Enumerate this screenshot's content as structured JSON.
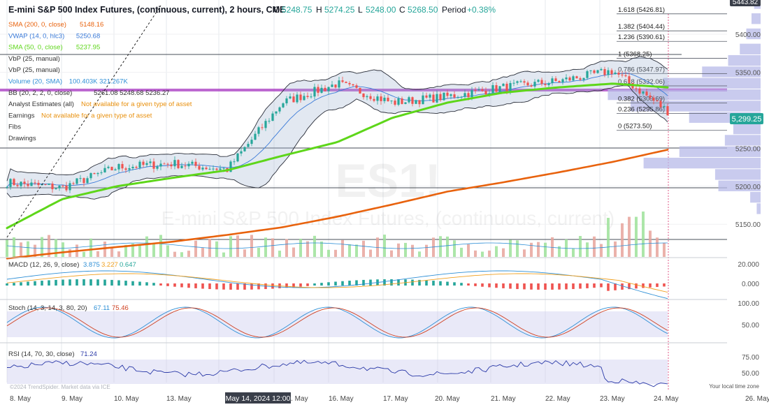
{
  "header": {
    "title": "E-mini S&P 500 Index Futures, (continuous, current), 2 hours, CME",
    "open_label": "O",
    "open": "5248.75",
    "high_label": "H",
    "high": "5274.25",
    "low_label": "L",
    "low": "5248.00",
    "close_label": "C",
    "close": "5268.50",
    "period_label": "Period",
    "period_change": "+0.38%"
  },
  "indicators": [
    {
      "name": "SMA (200, 0, close)",
      "value": "5148.16",
      "color": "#e8620d"
    },
    {
      "name": "VWAP (14, 0, hlc3)",
      "value": "5250.68",
      "color": "#3a7ad8"
    },
    {
      "name": "SMA (50, 0, close)",
      "value": "5237.95",
      "color": "#5ed61a"
    },
    {
      "name": "VbP (25, manual)",
      "value": "",
      "color": "#333333"
    },
    {
      "name": "VbP (25, manual)",
      "value": "",
      "color": "#333333"
    },
    {
      "name": "Volume (20, SMA)",
      "value": "100.403K  321.267K",
      "color": "#2e8fd6"
    },
    {
      "name": "BB (20, 2, 2, 0, close)",
      "value": "5261.08  5248.68  5236.27",
      "color": "#333333"
    },
    {
      "name": "Analyst Estimates (all)",
      "value": "Not available for a given type of asset",
      "color": "#e8900d"
    },
    {
      "name": "Earnings",
      "value": "Not available for a given type of asset",
      "color": "#e8900d"
    },
    {
      "name": "Fibs",
      "value": "",
      "color": "#333333"
    },
    {
      "name": "Drawings",
      "value": "",
      "color": "#333333"
    }
  ],
  "watermark": {
    "symbol": "ES1!",
    "name": "E-mini S&P 500 Index Futures, (continuous, current)"
  },
  "price_axis": {
    "ticks": [
      "5400.00",
      "5350.00",
      "5250.00",
      "5200.00",
      "5150.00"
    ],
    "top_badge": "5443.82",
    "current_badge": "5,299.25",
    "current_color": "#26a69a"
  },
  "fibs": [
    {
      "label": "1.618 (5426.81)",
      "price": 5426.81
    },
    {
      "label": "1.382 (5404.44)",
      "price": 5404.44
    },
    {
      "label": "1.236 (5390.61)",
      "price": 5390.61
    },
    {
      "label": "1 (5368.25)",
      "price": 5368.25
    },
    {
      "label": "0.786 (5347.97)",
      "price": 5347.97
    },
    {
      "label": "0.618 (5332.06)",
      "price": 5332.06
    },
    {
      "label": "0.382 (5309.69)",
      "price": 5309.69
    },
    {
      "label": "0.236 (5295.86)",
      "price": 5295.86
    },
    {
      "label": "0 (5273.50)",
      "price": 5273.5
    }
  ],
  "macd": {
    "label": "MACD (12, 26, 9, close)",
    "values": [
      "3.875",
      "3.227",
      "0.647"
    ],
    "ticks": [
      "20.000",
      "0.000"
    ]
  },
  "stoch": {
    "label": "Stoch (14, 3, 14, 3, 80, 20)",
    "values": [
      "67.11",
      "75.46"
    ],
    "ticks": [
      "100.00",
      "50.00"
    ]
  },
  "rsi": {
    "label": "RSI (14, 70, 30, close)",
    "value": "71.24",
    "ticks": [
      "75.00",
      "50.00"
    ]
  },
  "footer": {
    "copyright": "©2024 TrendSpider. Market data via ICE",
    "timezone": "Your local time zone"
  },
  "x_axis": {
    "labels": [
      "8. May",
      "9. May",
      "10. May",
      "13. May",
      "15. May",
      "16. May",
      "17. May",
      "20. May",
      "21. May",
      "22. May",
      "23. May",
      "24. May",
      "26. May"
    ],
    "crosshair_label": "May 14, 2024 12:00"
  },
  "chart_data": {
    "type": "line",
    "title": "E-mini S&P 500 Index Futures, (continuous, current), 2 hours, CME",
    "x": [
      "8. May",
      "9. May",
      "10. May",
      "13. May",
      "14. May",
      "15. May",
      "16. May",
      "17. May",
      "20. May",
      "21. May",
      "22. May",
      "23. May",
      "24. May"
    ],
    "ylim": [
      5130,
      5445
    ],
    "series": [
      {
        "name": "SMA (200, 0, close)",
        "values": [
          5105,
          5113,
          5120,
          5127,
          5136,
          5146,
          5160,
          5176,
          5193,
          5205,
          5218,
          5232,
          5248
        ]
      },
      {
        "name": "SMA (50, 0, close)",
        "values": [
          5145,
          5183,
          5200,
          5211,
          5221,
          5240,
          5258,
          5290,
          5310,
          5323,
          5330,
          5335,
          5330
        ]
      },
      {
        "name": "Close",
        "values": [
          5205,
          5198,
          5225,
          5230,
          5222,
          5310,
          5335,
          5310,
          5318,
          5330,
          5338,
          5352,
          5299
        ]
      }
    ],
    "volume_profile_levels": [
      5440,
      5420,
      5400,
      5380,
      5365,
      5350,
      5335,
      5320,
      5305,
      5290,
      5275,
      5260,
      5245,
      5230,
      5215,
      5200,
      5185,
      5170
    ],
    "volume_profile_values": [
      10,
      14,
      22,
      32,
      50,
      90,
      150,
      235,
      200,
      110,
      42,
      55,
      125,
      180,
      70,
      65,
      16,
      6
    ]
  }
}
